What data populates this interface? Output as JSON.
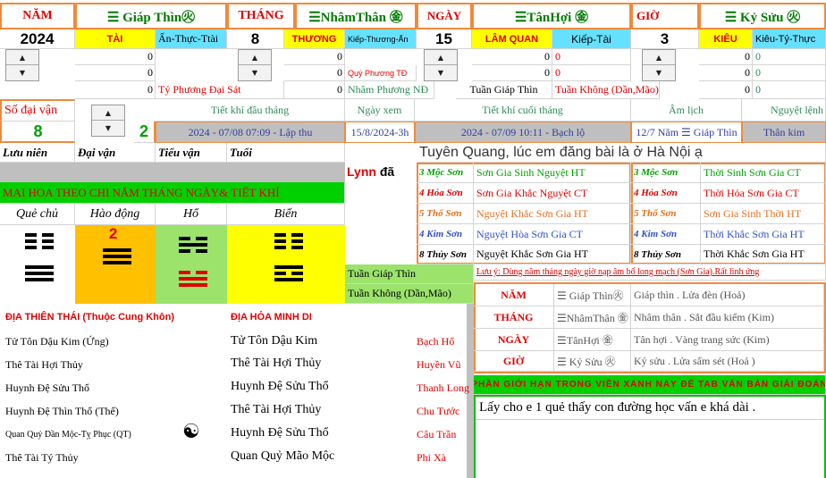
{
  "header": {
    "nam_label": "NĂM",
    "nam_can_chi": "☰ Giáp Thìn㊋",
    "thang_label": "THÁNG",
    "thang_can_chi": "☰NhâmThân ㊎",
    "ngay_label": "NGÀY",
    "ngay_can_chi": "☰TânHợi ㊎",
    "gio_label": "GIỜ",
    "gio_can_chi": "☰ Kỷ Sửu ㊋"
  },
  "values": {
    "year": "2024",
    "year_role": "TÀI",
    "year_star": "Ấn-Thực-Ttài",
    "month": "8",
    "month_role": "THƯƠNG",
    "month_star": "Kiếp-Thương-Ấn",
    "day": "15",
    "day_role": "LÂM QUAN",
    "day_star": "Kiếp-Tài",
    "hour": "3",
    "hour_role": "KIÊU",
    "hour_star": "Kiêu-Tỷ-Thực"
  },
  "zeros": [
    "0",
    "0",
    "0",
    "0",
    "0",
    "0",
    "0",
    "0",
    "0",
    "0",
    "0",
    "0",
    "0",
    "0",
    "0",
    "0",
    "0",
    "0"
  ],
  "notes": {
    "ty_phuong": "Tỷ Phương Đại Sát",
    "quy_phuong": "Quý Phương TĐ",
    "nham_phuong": "Nhâm Phương NĐ",
    "tuan_giap": "Tuần Giáp Thìn",
    "tuan_khong": "Tuần Không (Dần,Mão)"
  },
  "daivan": {
    "label": "Số đại vận",
    "value": "8",
    "value2": "2",
    "tiet_dau_label": "Tiết khí đầu tháng",
    "tiet_dau": "2024 - 07/08 07:09 - Lập thu",
    "ngay_xem_label": "Ngày xem",
    "ngay_xem": "15/8/2024-3h",
    "tiet_cuoi_label": "Tiết khí cuối tháng",
    "tiet_cuoi": "2024 - 07/09 10:11 - Bạch lộ",
    "am_lich_label": "Âm lịch",
    "am_lich": "12/7 Năm ☰ Giáp Thìn",
    "nguyet_lenh_label": "Nguyệt lệnh",
    "nguyet_lenh": "Thân kim"
  },
  "row_labels": {
    "luu_nien": "Lưu niên",
    "dai_van": "Đại vận",
    "tieu_van": "Tiểu vận",
    "tuoi": "Tuổi"
  },
  "message": "Tuyên Quang, lúc em đăng bài là ở Hà Nội ạ",
  "lynn": "Lynn",
  "lynn_suffix": "đã",
  "mai_hoa": {
    "title": "MAI HOA THEO CHI NĂM THÁNG NGÀY& TIẾT KHÍ",
    "que_chu": "Quẻ chủ",
    "hao_dong": "Hào động",
    "ho": "Hổ",
    "bien": "Biến",
    "hao_dong_value": "2",
    "tuan_giap": "Tuần Giáp Thìn",
    "tuan_khong": "Tuần Không (Dần,Mão)"
  },
  "son_table": {
    "left": [
      {
        "k": "3 Mộc Sơn",
        "v": "Sơn Gia Sinh Nguyệt HT"
      },
      {
        "k": "4 Hỏa Sơn",
        "v": "Sơn Gia Khắc Nguyệt CT"
      },
      {
        "k": "5 Thổ Sơn",
        "v": "Nguyệt Khắc Sơn Gia HT"
      },
      {
        "k": "4 Kim Sơn",
        "v": "Nguyệt Hòa Sơn Gia CT"
      },
      {
        "k": "8 Thủy Sơn",
        "v": "Nguyệt Khắc Sơn Gia HT"
      }
    ],
    "right": [
      {
        "k": "3 Mộc Sơn",
        "v": "Thời Sinh Sơn Gia CT"
      },
      {
        "k": "4 Hỏa Sơn",
        "v": "Thời Hỏa Sơn Gia CT"
      },
      {
        "k": "5 Thổ Sơn",
        "v": "Sơn Gia Sinh Thời HT"
      },
      {
        "k": "4 Kim Sơn",
        "v": "Thời Khắc Sơn Gia HT"
      },
      {
        "k": "8 Thủy Sơn",
        "v": "Thời Khắc Sơn Gia HT"
      }
    ]
  },
  "luu_y": "Lưu ý: Dùng năm tháng ngày giờ nạp âm bổ long mạch (Sơn Gia).Rất linh ứng",
  "nap_am": [
    {
      "k": "NĂM",
      "c": "☰ Giáp Thìn㊋",
      "v": "Giáp thìn . Lửa đèn (Hoả)"
    },
    {
      "k": "THÁNG",
      "c": "☰NhâmThân ㊎",
      "v": "Nhâm thân . Sắt đầu kiếm (Kim)"
    },
    {
      "k": "NGÀY",
      "c": "☰TânHợi ㊎",
      "v": "Tân hợi . Vàng trang sức (Kim)"
    },
    {
      "k": "GIỜ",
      "c": "☰ Kỷ Sửu ㊋",
      "v": "Kỷ sửu . Lửa sấm sét (Hoả )"
    }
  ],
  "gioi_han": "PHẦN GIỚI HẠN TRONG VIỀN XANH NÀY ĐỂ TAB VĂN BẢN GIẢI ĐOÁN",
  "giai_doan": "Lấy cho e 1 quẻ thấy con đường học vấn e khá dài .",
  "dia1": {
    "title": "ĐỊA THIÊN THÁI (Thuộc Cung Khôn)",
    "lines": [
      "Tử Tôn Dậu Kim (Ứng)",
      "Thê Tài Hợi Thủy",
      "Huynh Đệ Sửu Thổ",
      "Huynh Đệ Thìn Thổ (Thế)",
      "Quan Quỷ Dần Mộc-Tỵ Phục (QT)",
      "Thê Tài Tý Thủy"
    ]
  },
  "dia2": {
    "title": "ĐỊA HỎA MINH DI",
    "lines": [
      "Tử Tôn Dậu Kim",
      "Thê Tài Hợi Thủy",
      "Huynh Đệ Sửu Thổ",
      "Thê Tài Hợi Thủy",
      "Huynh Đệ Sửu Thổ",
      "Quan Quỷ Mão Mộc"
    ]
  },
  "luc_than": [
    "Bạch Hổ",
    "Huyền Vũ",
    "Thanh Long",
    "Chu Tước",
    "Câu Trần",
    "Phi Xà"
  ],
  "yin_yang_icon": "☯"
}
